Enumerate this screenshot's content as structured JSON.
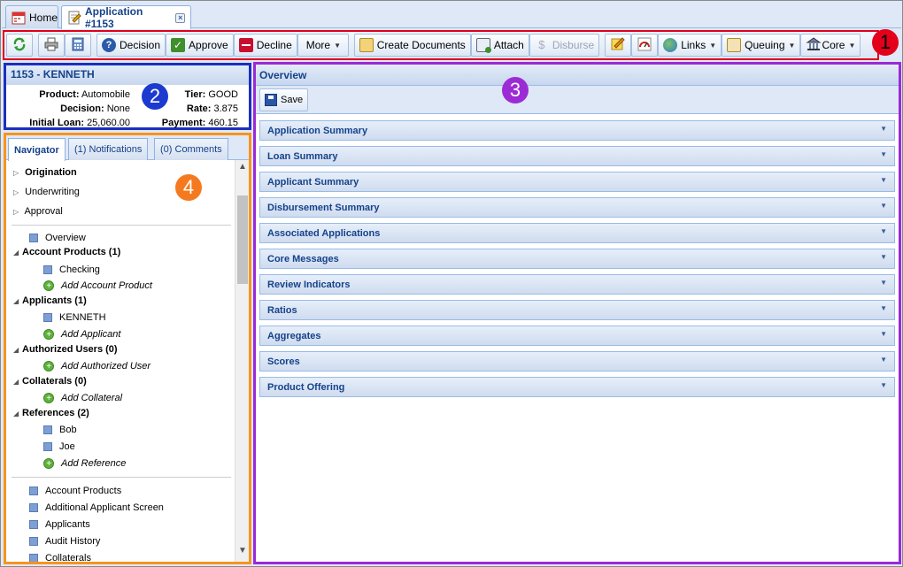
{
  "tabs": {
    "home": "Home",
    "application": "Application #1153"
  },
  "toolbar": {
    "decision": "Decision",
    "approve": "Approve",
    "decline": "Decline",
    "more": "More",
    "create_documents": "Create Documents",
    "attach": "Attach",
    "disburse": "Disburse",
    "links": "Links",
    "queuing": "Queuing",
    "core": "Core"
  },
  "badges": [
    "1",
    "2",
    "3",
    "4"
  ],
  "summary": {
    "title": "1153 - KENNETH",
    "product_label": "Product:",
    "product": "Automobile",
    "decision_label": "Decision:",
    "decision": "None",
    "initial_loan_label": "Initial Loan:",
    "initial_loan": "25,060.00",
    "tier_label": "Tier:",
    "tier": "GOOD",
    "rate_label": "Rate:",
    "rate": "3.875",
    "payment_label": "Payment:",
    "payment": "460.15"
  },
  "navigator": {
    "tabs": [
      "Navigator",
      "(1) Notifications",
      "(0) Comments"
    ],
    "groups": [
      "Origination",
      "Underwriting",
      "Approval"
    ],
    "overview": "Overview",
    "account_products": "Account Products (1)",
    "checking": "Checking",
    "add_account_product": "Add Account Product",
    "applicants": "Applicants (1)",
    "applicant_name": "KENNETH",
    "add_applicant": "Add Applicant",
    "authorized_users": "Authorized Users (0)",
    "add_authorized_user": "Add Authorized User",
    "collaterals": "Collaterals (0)",
    "add_collateral": "Add Collateral",
    "references": "References (2)",
    "ref1": "Bob",
    "ref2": "Joe",
    "add_reference": "Add Reference",
    "screens": [
      "Account Products",
      "Additional Applicant Screen",
      "Applicants",
      "Audit History",
      "Collaterals"
    ]
  },
  "main": {
    "title": "Overview",
    "save": "Save",
    "sections": [
      "Application Summary",
      "Loan Summary",
      "Applicant Summary",
      "Disbursement Summary",
      "Associated Applications",
      "Core Messages",
      "Review Indicators",
      "Ratios",
      "Aggregates",
      "Scores",
      "Product Offering"
    ]
  }
}
